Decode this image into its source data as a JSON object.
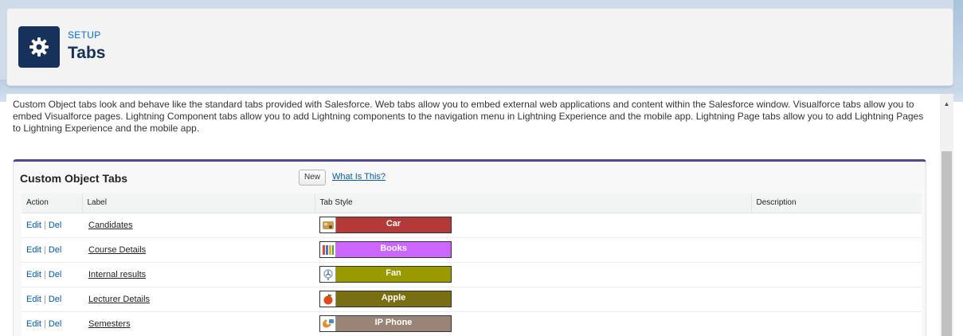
{
  "header": {
    "breadcrumb": "SETUP",
    "title": "Tabs",
    "icon": "gear-icon"
  },
  "description": "Custom Object tabs look and behave like the standard tabs provided with Salesforce. Web tabs allow you to embed external web applications and content within the Salesforce window. Visualforce tabs allow you to embed Visualforce pages. Lightning Component tabs allow you to add Lightning components to the navigation menu in Lightning Experience and the mobile app. Lightning Page tabs allow you to add Lightning Pages to Lightning Experience and the mobile app.",
  "related_list": {
    "title": "Custom Object Tabs",
    "new_label": "New",
    "help_link": "What Is This?",
    "accent_color": "#56458c",
    "columns": [
      "Action",
      "Label",
      "Tab Style",
      "Description"
    ],
    "edit_label": "Edit",
    "separator": "|",
    "del_label": "Del",
    "rows": [
      {
        "label": "Candidates",
        "style_name": "Car",
        "style_color": "#b43a3a",
        "icon": "car-icon",
        "description": ""
      },
      {
        "label": "Course Details",
        "style_name": "Books",
        "style_color": "#cc66ff",
        "icon": "books-icon",
        "description": ""
      },
      {
        "label": "Internal results",
        "style_name": "Fan",
        "style_color": "#999900",
        "icon": "fan-icon",
        "description": ""
      },
      {
        "label": "Lecturer Details",
        "style_name": "Apple",
        "style_color": "#7a6e12",
        "icon": "apple-icon",
        "description": ""
      },
      {
        "label": "Semesters",
        "style_name": "IP Phone",
        "style_color": "#9a8478",
        "icon": "phone-icon",
        "description": ""
      }
    ]
  }
}
